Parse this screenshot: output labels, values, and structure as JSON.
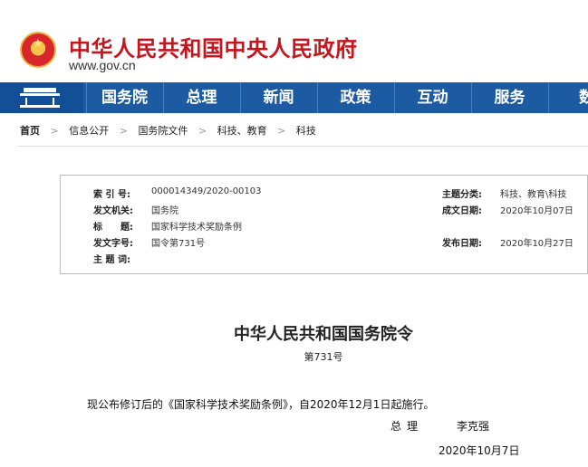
{
  "header": {
    "site_title": "中华人民共和国中央人民政府",
    "site_url": "www.gov.cn"
  },
  "nav": {
    "items": [
      "国务院",
      "总理",
      "新闻",
      "政策",
      "互动",
      "服务",
      "数"
    ]
  },
  "breadcrumb": {
    "items": [
      "首页",
      "信息公开",
      "国务院文件",
      "科技、教育",
      "科技"
    ],
    "separator": ">"
  },
  "info": {
    "index_label": "索 引 号:",
    "index_value": "000014349/2020-00103",
    "category_label": "主题分类:",
    "category_value": "科技、教育\\科技",
    "issuer_label": "发文机关:",
    "issuer_value": "国务院",
    "created_label": "成文日期:",
    "created_value": "2020年10月07日",
    "title_label": "标　　题:",
    "title_value": "国家科学技术奖励条例",
    "docno_label": "发文字号:",
    "docno_value": "国令第731号",
    "published_label": "发布日期:",
    "published_value": "2020年10月27日",
    "keywords_label": "主 题 词:",
    "keywords_value": ""
  },
  "document": {
    "title": "中华人民共和国国务院令",
    "number": "第731号",
    "body": "现公布修订后的《国家科学技术奖励条例》，自2020年12月1日起施行。",
    "signer_title": "总理",
    "signer_name": "李克强",
    "date": "2020年10月7日"
  },
  "colors": {
    "brand_red": "#c5161d",
    "nav_blue": "#1c5aa1"
  }
}
